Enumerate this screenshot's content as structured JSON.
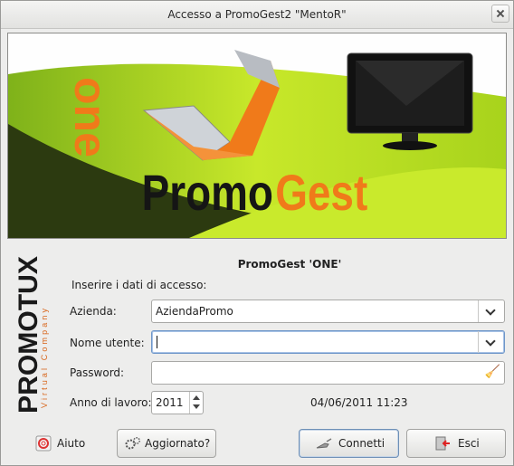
{
  "window": {
    "title": "Accesso a PromoGest2 \"MentoR\""
  },
  "banner": {
    "brand_one": "one",
    "brand_promo": "Promo",
    "brand_gest": "Gest"
  },
  "logo": {
    "main": "PROMOTUX",
    "sub": "Virtual Company"
  },
  "form": {
    "heading": "PromoGest 'ONE'",
    "intro": "Inserire i dati di accesso:",
    "azienda_label": "Azienda:",
    "azienda_value": "AziendaPromo",
    "utente_label": "Nome utente:",
    "utente_value": "",
    "password_label": "Password:",
    "password_value": "",
    "anno_label": "Anno di lavoro:",
    "anno_value": "2011",
    "datetime": "04/06/2011  11:23"
  },
  "buttons": {
    "help": "Aiuto",
    "update": "Aggiornato?",
    "connect": "Connetti",
    "exit": "Esci"
  },
  "colors": {
    "accent_orange": "#f07a1a",
    "banner_green": "#b5dc1a",
    "focus_blue": "#6e96c8"
  }
}
